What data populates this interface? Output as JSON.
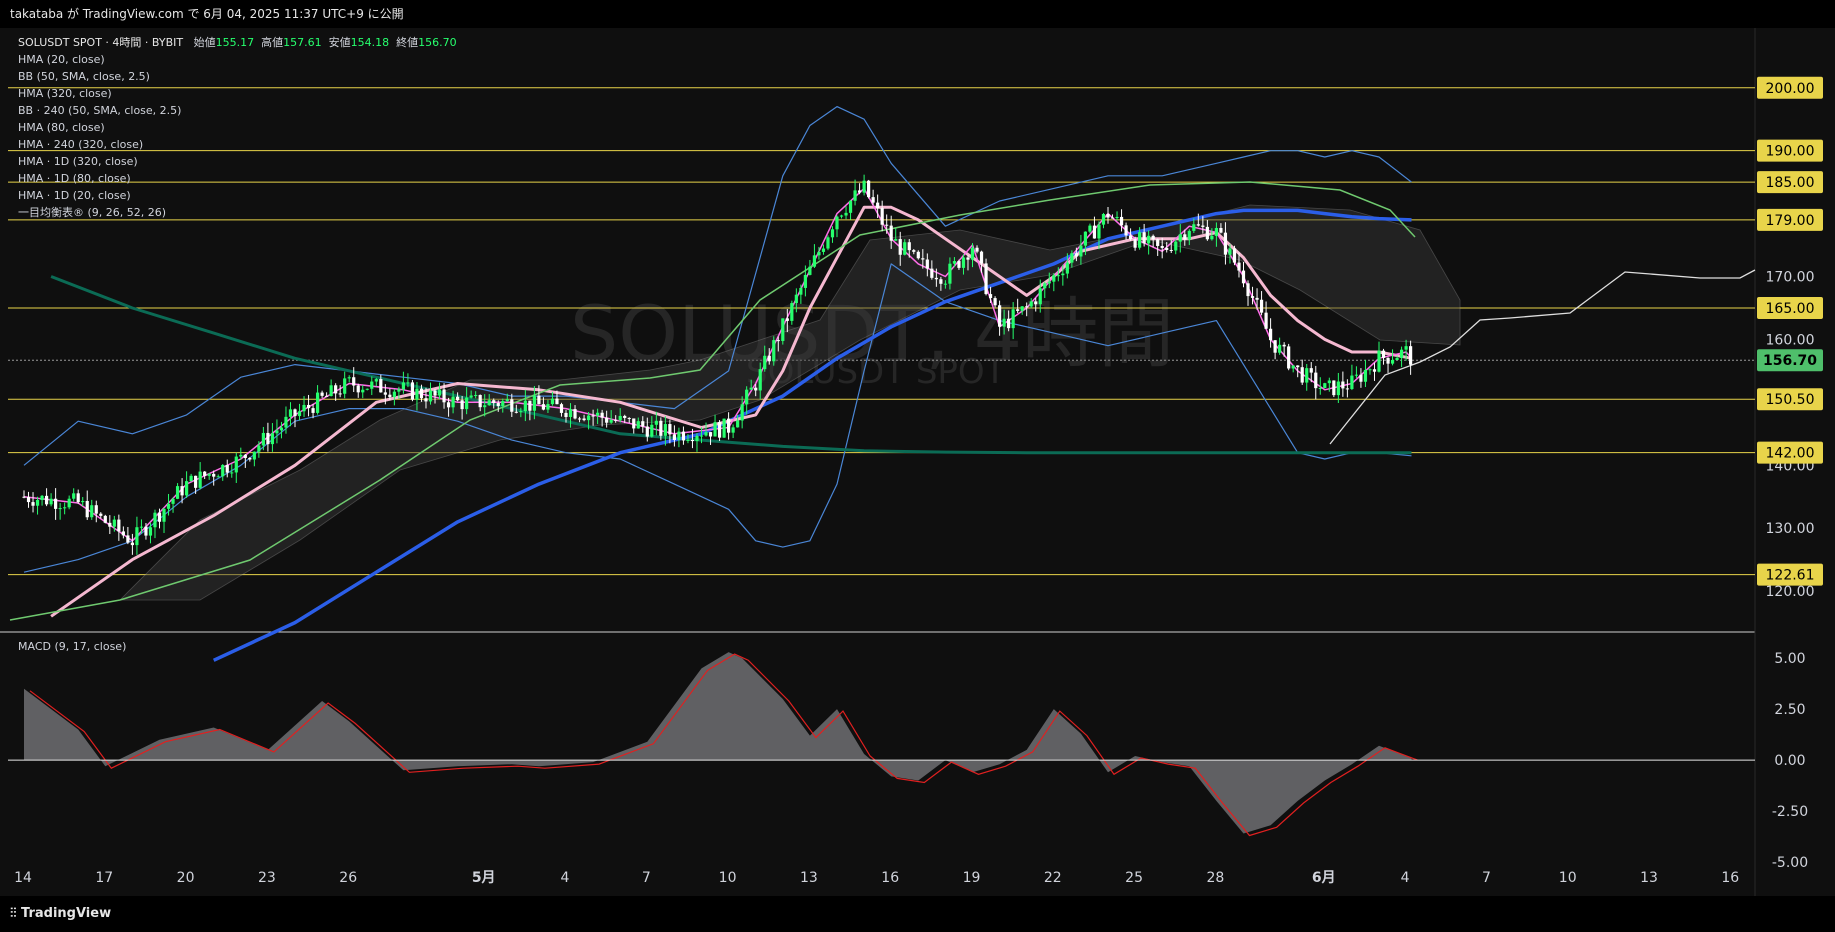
{
  "header": {
    "publish_line": "takataba が TradingView.com で 6月 04, 2025 11:37 UTC+9 に公開"
  },
  "legend": {
    "symbol_line": "SOLUSDT SPOT · 4時間 · BYBIT",
    "open_label": "始値",
    "open": "155.17",
    "high_label": "高値",
    "high": "157.61",
    "low_label": "安値",
    "low": "154.18",
    "close_label": "終値",
    "close": "156.70",
    "indicators": [
      "HMA (20, close)",
      "BB (50, SMA, close, 2.5)",
      "HMA (320, close)",
      "BB · 240 (50, SMA, close, 2.5)",
      "HMA (80, close)",
      "HMA · 240 (320, close)",
      "HMA · 1D (320, close)",
      "HMA · 1D (80, close)",
      "HMA · 1D (20, close)",
      "一目均衡表® (9, 26, 52, 26)"
    ]
  },
  "watermark": {
    "big": "SOLUSDT, 4時間",
    "small": "SOLUSDT SPOT"
  },
  "macd_label": "MACD (9, 17, close)",
  "footer": {
    "brand": "TradingView"
  },
  "colors": {
    "background": "#0f0f0f",
    "hline": "#e8d44a",
    "candle_up": "#26ff6d",
    "candle_down": "#ffffff",
    "hma20": "#ff6ee8",
    "hma80_1d": "#f5b8d0",
    "hma320": "#2b5ee8",
    "hma_dark_green": "#0b6b55",
    "bb": "#4a86d6",
    "green_ma": "#6fc96f",
    "macd_line": "#e02020",
    "macd_fill": "#6e6e72",
    "price_label": "#4fbf6b"
  },
  "chart_data": {
    "type": "line",
    "title": "SOLUSDT SPOT · 4時間 · BYBIT",
    "price_axis": {
      "min": 113.5,
      "max": 206,
      "ticks": [
        "200.00",
        "190.00",
        "185.00",
        "179.00",
        "170.00",
        "165.00",
        "160.00",
        "156.70",
        "150.50",
        "142.00",
        "140.00",
        "130.00",
        "122.61",
        "120.00"
      ],
      "tick_values": [
        200,
        190,
        185,
        179,
        170,
        165,
        160,
        156.7,
        150.5,
        142,
        140,
        130,
        122.61,
        120
      ]
    },
    "horizontal_lines": [
      {
        "value": 200.0,
        "label": "200.00"
      },
      {
        "value": 190.0,
        "label": "190.00"
      },
      {
        "value": 185.0,
        "label": "185.00"
      },
      {
        "value": 179.0,
        "label": "179.00"
      },
      {
        "value": 165.0,
        "label": "165.00"
      },
      {
        "value": 150.5,
        "label": "150.50"
      },
      {
        "value": 142.0,
        "label": "142.00"
      },
      {
        "value": 122.61,
        "label": "122.61"
      }
    ],
    "current_price": {
      "value": 156.7,
      "label": "156.70"
    },
    "x_axis": {
      "labels": [
        "14",
        "17",
        "20",
        "23",
        "26",
        "5月",
        "4",
        "7",
        "10",
        "13",
        "16",
        "19",
        "22",
        "25",
        "28",
        "6月",
        "4",
        "7",
        "10",
        "13",
        "16"
      ],
      "day_index": [
        0,
        3,
        6,
        9,
        12,
        17,
        20,
        23,
        26,
        29,
        32,
        35,
        38,
        41,
        44,
        48,
        51,
        54,
        57,
        60,
        63
      ]
    },
    "series": [
      {
        "name": "HMA (20, close)",
        "x": [
          0,
          2,
          4,
          6,
          8,
          10,
          12,
          14,
          16,
          18,
          20,
          22,
          24,
          26,
          27,
          28,
          29,
          30,
          31,
          32,
          33,
          34,
          35,
          36,
          37,
          38,
          39,
          40,
          41,
          42,
          43,
          44,
          45,
          46,
          47,
          48,
          49,
          50,
          51,
          51.2
        ],
        "values": [
          135,
          134,
          128,
          137,
          141,
          148,
          153,
          152,
          150,
          150,
          149,
          147,
          145,
          146,
          153,
          162,
          171,
          180,
          184,
          176,
          172,
          170,
          175,
          162,
          165,
          170,
          175,
          180,
          176,
          174,
          178,
          177,
          170,
          160,
          155,
          152,
          153,
          157,
          158,
          157
        ]
      },
      {
        "name": "HMA · 1D (80, close)",
        "x": [
          1,
          4,
          7,
          10,
          13,
          16,
          19,
          22,
          25,
          27,
          28,
          29,
          30,
          31,
          32,
          33,
          34,
          35,
          36,
          37,
          38,
          39,
          40,
          41,
          42,
          43,
          44,
          45,
          46,
          47,
          48,
          49,
          50,
          51.2
        ],
        "values": [
          116,
          125,
          132,
          140,
          150,
          153,
          152,
          150,
          146,
          148,
          155,
          165,
          173,
          181,
          181,
          179,
          176,
          173,
          170,
          167,
          170,
          174,
          175,
          176,
          176,
          176,
          177,
          173,
          167,
          163,
          160,
          158,
          158,
          157
        ]
      },
      {
        "name": "HMA (320, close)",
        "x": [
          7,
          10,
          13,
          16,
          19,
          22,
          25,
          26,
          28,
          30,
          32,
          34,
          36,
          38,
          40,
          42,
          44,
          45,
          46,
          47,
          48,
          49,
          50,
          51.2
        ],
        "values": [
          109,
          115,
          123,
          131,
          137,
          142,
          145,
          147,
          151,
          157,
          162,
          166,
          169,
          172,
          176,
          178,
          180,
          180.5,
          180.5,
          180.5,
          180,
          179.5,
          179.2,
          179
        ]
      },
      {
        "name": "HMA · 1D (320, close)",
        "x": [
          1,
          4,
          7,
          10,
          13,
          16,
          19,
          22,
          25,
          28,
          31,
          34,
          37,
          40,
          43,
          46,
          49,
          51.2
        ],
        "values": [
          170,
          165,
          161,
          157,
          154,
          151,
          148,
          145,
          144,
          143,
          142.3,
          142.1,
          142,
          142,
          142,
          142,
          142,
          142
        ]
      },
      {
        "name": "BB upper",
        "x": [
          0,
          2,
          4,
          6,
          8,
          10,
          12,
          14,
          16,
          18,
          20,
          22,
          24,
          26,
          28,
          29,
          30,
          31,
          32,
          34,
          36,
          38,
          40,
          42,
          44,
          45,
          46,
          47,
          48,
          49,
          50,
          51.2
        ],
        "values": [
          140,
          147,
          145,
          148,
          154,
          156,
          155,
          154,
          153,
          151,
          151,
          150,
          149,
          155,
          186,
          194,
          197,
          195,
          188,
          178,
          182,
          184,
          186,
          186,
          188,
          189,
          190,
          190,
          189,
          190,
          189,
          185
        ]
      },
      {
        "name": "BB lower",
        "x": [
          0,
          2,
          4,
          6,
          8,
          10,
          12,
          14,
          16,
          18,
          20,
          22,
          24,
          26,
          27,
          28,
          29,
          30,
          31,
          32,
          34,
          36,
          38,
          40,
          42,
          44,
          45,
          46,
          47,
          48,
          49,
          50,
          51.2
        ],
        "values": [
          123,
          125,
          128,
          135,
          140,
          147,
          149,
          149,
          147,
          144,
          142,
          141,
          137,
          133,
          128,
          127,
          128,
          137,
          155,
          172,
          166,
          163,
          161,
          159,
          161,
          163,
          156,
          149,
          142,
          141,
          142,
          142,
          141.5
        ]
      },
      {
        "name": "MACD (9, 17, close)",
        "x": [
          0,
          2,
          3,
          5,
          7,
          9,
          11,
          12,
          14,
          16,
          18,
          19,
          21,
          23,
          25,
          26,
          26.5,
          28,
          29,
          30,
          31,
          32,
          33,
          34,
          35,
          36,
          37,
          38,
          39,
          40,
          41,
          42,
          43,
          44,
          45,
          46,
          47,
          48,
          49,
          50,
          51.2
        ],
        "values": [
          3.5,
          1.5,
          -0.3,
          1,
          1.6,
          0.5,
          2.9,
          1.9,
          -0.5,
          -0.3,
          -0.2,
          -0.3,
          -0.1,
          0.9,
          4.5,
          5.3,
          5,
          3,
          1.2,
          2.5,
          0.3,
          -0.8,
          -1,
          0,
          -0.6,
          -0.2,
          0.5,
          2.5,
          1.3,
          -0.6,
          0.2,
          -0.1,
          -0.3,
          -2,
          -3.6,
          -3.2,
          -2,
          -1,
          -0.2,
          0.7,
          0.1
        ]
      }
    ],
    "macd_axis": {
      "min": -5,
      "max": 5.5,
      "ticks": [
        "5.00",
        "2.50",
        "0.00",
        "-2.50",
        "-5.00"
      ],
      "tick_values": [
        5,
        2.5,
        0,
        -2.5,
        -5
      ]
    }
  }
}
